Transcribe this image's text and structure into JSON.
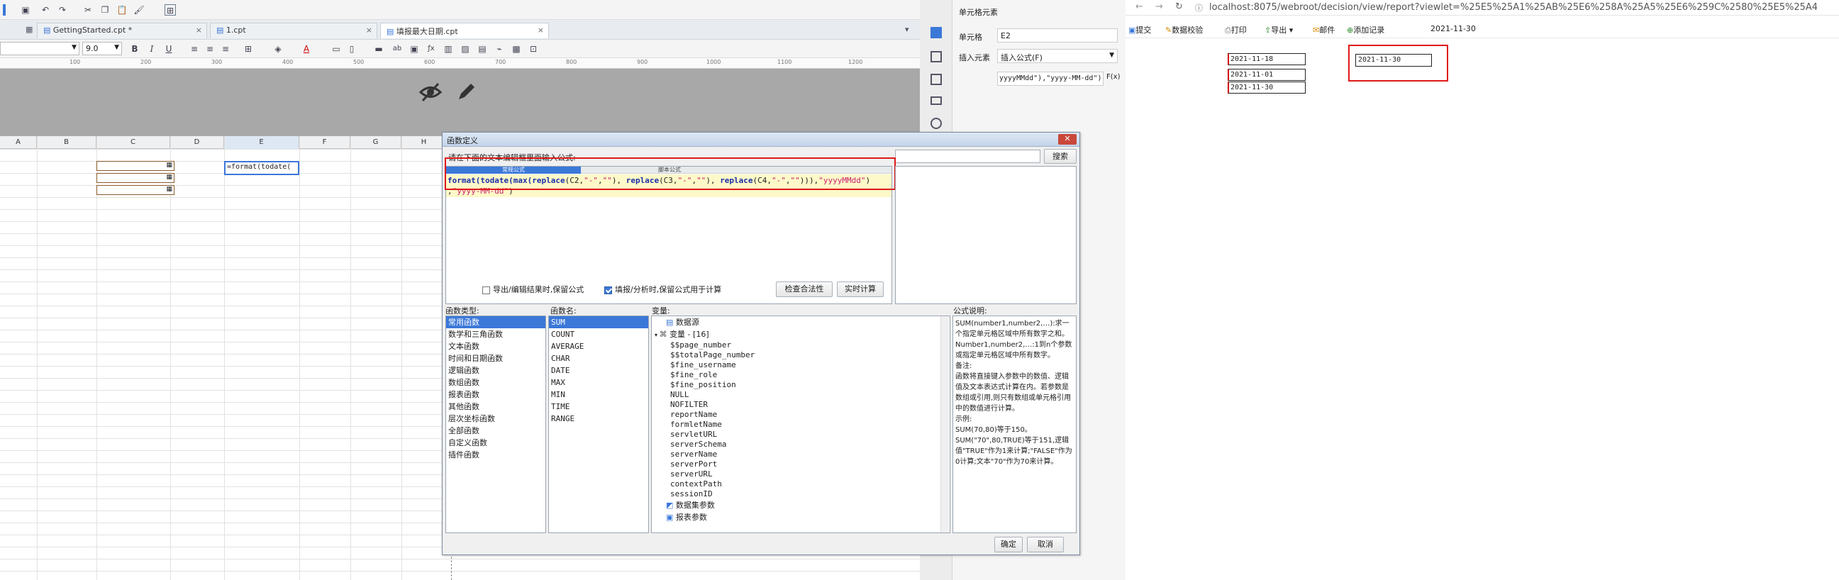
{
  "designer": {
    "tabs": [
      {
        "label": "GettingStarted.cpt *",
        "close": "×"
      },
      {
        "label": "1.cpt",
        "close": "×"
      },
      {
        "label": "填报最大日期.cpt",
        "close": "×"
      }
    ],
    "font_size_value": "9.0",
    "toolbar_btn_bold": "B",
    "toolbar_btn_italic": "I",
    "toolbar_btn_underline": "U",
    "ruler_marks": [
      "100",
      "200",
      "300",
      "400",
      "500",
      "600",
      "700",
      "800",
      "900",
      "1000",
      "1100",
      "1200"
    ],
    "columns": [
      "A",
      "B",
      "C",
      "D",
      "E",
      "F",
      "G",
      "H"
    ],
    "cell_e2_text": "=format(todate("
  },
  "right_panel": {
    "title": "单元格元素",
    "cell_label": "单元格",
    "cell_value": "E2",
    "insert_label": "插入元素",
    "insert_value": "插入公式(F)",
    "formula_preview": "yyyyMMdd\"),\"yyyy-MM-dd\")",
    "fx_label": "F(x)"
  },
  "browser": {
    "url": "localhost:8075/webroot/decision/view/report?viewlet=%25E5%25A1%25AB%25E6%258A%25A5%25E6%259C%2580%25E5%25A4",
    "toolbar": [
      "提交",
      "数据校验",
      "打印",
      "导出",
      "邮件",
      "添加记录"
    ],
    "toolbar_date": "2021-11-30",
    "dates": [
      "2021-11-18",
      "2021-11-01",
      "2021-11-30"
    ],
    "result_value": "2021-11-30"
  },
  "dialog": {
    "title": "函数定义",
    "prompt": "请在下面的文本编辑框里面输入公式:",
    "search_button": "搜索",
    "mode_tabs": [
      "常规公式",
      "脚本公式"
    ],
    "formula_line1_parts": [
      {
        "t": "format(todate(max(",
        "k": "fn"
      },
      {
        "t": "replace",
        "k": "fn"
      },
      {
        "t": "(C2,",
        "k": "plain"
      },
      {
        "t": "\"-\"",
        "k": "str"
      },
      {
        "t": ",",
        "k": "plain"
      },
      {
        "t": "\"\"",
        "k": "str"
      },
      {
        "t": "), ",
        "k": "plain"
      },
      {
        "t": "replace",
        "k": "fn"
      },
      {
        "t": "(C3,",
        "k": "plain"
      },
      {
        "t": "\"-\"",
        "k": "str"
      },
      {
        "t": ",",
        "k": "plain"
      },
      {
        "t": "\"\"",
        "k": "str"
      },
      {
        "t": "), ",
        "k": "plain"
      },
      {
        "t": "replace",
        "k": "fn"
      },
      {
        "t": "(C4,",
        "k": "plain"
      },
      {
        "t": "\"-\"",
        "k": "str"
      },
      {
        "t": ",",
        "k": "plain"
      },
      {
        "t": "\"\"",
        "k": "str"
      },
      {
        "t": "))),",
        "k": "plain"
      },
      {
        "t": "\"yyyyMMdd\"",
        "k": "str"
      },
      {
        "t": ")",
        "k": "plain"
      }
    ],
    "formula_line2_parts": [
      {
        "t": ",",
        "k": "plain"
      },
      {
        "t": "\"yyyy-MM-dd\"",
        "k": "str"
      },
      {
        "t": ")",
        "k": "plain"
      }
    ],
    "checkbox_export": "导出/编辑结果时,保留公式",
    "checkbox_fill": "填报/分析时,保留公式用于计算",
    "btn_check": "检查合法性",
    "btn_realtime": "实时计算",
    "col_type": "函数类型:",
    "col_name": "函数名:",
    "col_var": "变量:",
    "col_desc": "公式说明:",
    "func_types": [
      "常用函数",
      "数学和三角函数",
      "文本函数",
      "时间和日期函数",
      "逻辑函数",
      "数组函数",
      "报表函数",
      "其他函数",
      "层次坐标函数",
      "全部函数",
      "自定义函数",
      "插件函数"
    ],
    "func_names": [
      "SUM",
      "COUNT",
      "AVERAGE",
      "CHAR",
      "DATE",
      "MAX",
      "MIN",
      "TIME",
      "RANGE"
    ],
    "var_datasource": "数据源",
    "var_group": "变量 - [16]",
    "var_items": [
      "$$page_number",
      "$$totalPage_number",
      "$fine_username",
      "$fine_role",
      "$fine_position",
      "NULL",
      "NOFILTER",
      "reportName",
      "formletName",
      "servletURL",
      "serverSchema",
      "serverName",
      "serverPort",
      "serverURL",
      "contextPath",
      "sessionID"
    ],
    "var_dataset_params": "数据集参数",
    "var_report_params": "报表参数",
    "description": "SUM(number1,number2,…):求一个指定单元格区域中所有数字之和。\nNumber1,number2,…:1到n个参数或指定单元格区域中所有数字。\n备注:\n函数将直接键入参数中的数值、逻辑值及文本表达式计算在内。若参数是数组或引用,则只有数组或单元格引用中的数值进行计算。\n示例:\nSUM(70,80)等于150。\nSUM(\"70\",80,TRUE)等于151,逻辑值\"TRUE\"作为1来计算;\"FALSE\"作为0计算;文本\"70\"作为70来计算。",
    "btn_ok": "确定",
    "btn_cancel": "取消"
  },
  "colors": {
    "accent": "#3b78d8",
    "highlight_red": "#e01818",
    "formula_fn": "#1a2fa8",
    "formula_str": "#c81e6e",
    "formula_line_bg": "#fdf9c8"
  }
}
